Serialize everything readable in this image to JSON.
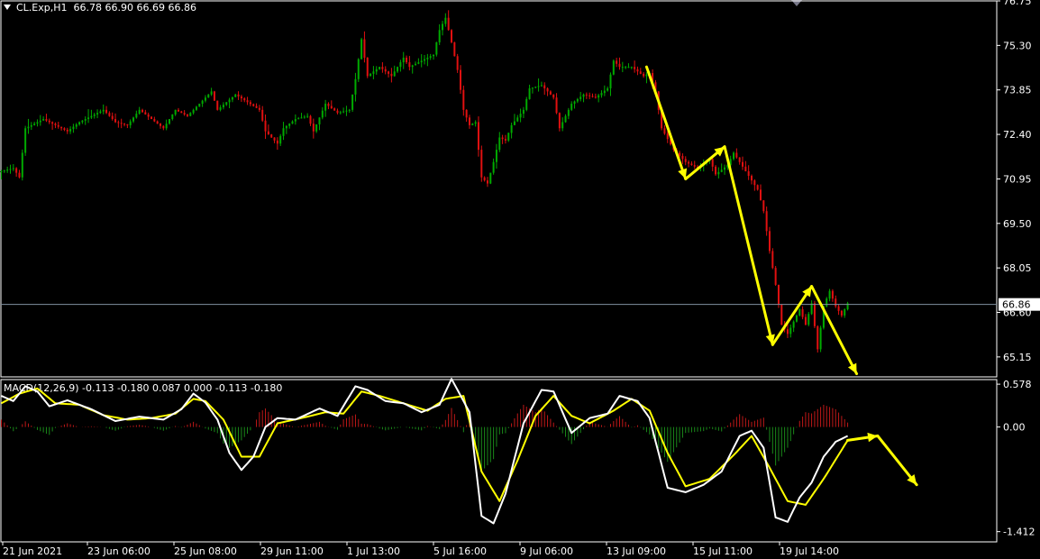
{
  "header": {
    "symbol_line": "CL.Exp,H1  66.78 66.90 66.69 66.86",
    "macd_line": "MACD(12,26,9) -0.113 -0.180 0.087 0.000 -0.113 -0.180"
  },
  "colors": {
    "background": "#000000",
    "frame": "#ffffff",
    "bull_candle": "#00aa00",
    "bear_candle": "#e01010",
    "macd_line": "#ffffff",
    "signal_line": "#ffff00",
    "hist_positive": "#c01818",
    "hist_negative": "#1a8a1a",
    "arrow": "#ffff00",
    "price_line": "#8090a0"
  },
  "icons": {
    "menu": "triangle-down-icon",
    "scroll": "triangle-down-icon"
  },
  "chart_data": [
    {
      "type": "candlestick",
      "title": "CL.Exp,H1",
      "ylim": [
        64.5,
        76.75
      ],
      "y_ticks": [
        "76.75",
        "75.30",
        "73.85",
        "72.40",
        "70.95",
        "69.50",
        "68.05",
        "66.60",
        "65.15"
      ],
      "current_price": "66.86",
      "x_ticks": [
        "21 Jun 2021",
        "23 Jun 06:00",
        "25 Jun 08:00",
        "29 Jun 11:00",
        "1 Jul 13:00",
        "5 Jul 16:00",
        "9 Jul 06:00",
        "13 Jul 09:00",
        "15 Jul 11:00",
        "19 Jul 14:00"
      ],
      "close_path": [
        [
          0,
          71.2
        ],
        [
          4,
          71.3
        ],
        [
          6,
          71.0
        ],
        [
          8,
          72.6
        ],
        [
          14,
          72.9
        ],
        [
          18,
          72.7
        ],
        [
          22,
          72.5
        ],
        [
          26,
          72.8
        ],
        [
          30,
          73.0
        ],
        [
          34,
          73.2
        ],
        [
          38,
          72.8
        ],
        [
          42,
          72.7
        ],
        [
          46,
          73.2
        ],
        [
          50,
          72.9
        ],
        [
          54,
          72.6
        ],
        [
          58,
          73.2
        ],
        [
          62,
          73.0
        ],
        [
          66,
          73.4
        ],
        [
          70,
          73.8
        ],
        [
          72,
          73.2
        ],
        [
          78,
          73.7
        ],
        [
          86,
          73.2
        ],
        [
          88,
          72.5
        ],
        [
          92,
          72.1
        ],
        [
          94,
          72.6
        ],
        [
          98,
          72.9
        ],
        [
          102,
          73.0
        ],
        [
          104,
          72.5
        ],
        [
          108,
          73.4
        ],
        [
          112,
          73.1
        ],
        [
          116,
          73.2
        ],
        [
          118,
          74.2
        ],
        [
          120,
          75.5
        ],
        [
          122,
          74.3
        ],
        [
          126,
          74.6
        ],
        [
          130,
          74.3
        ],
        [
          134,
          74.9
        ],
        [
          136,
          74.6
        ],
        [
          140,
          74.8
        ],
        [
          144,
          75.0
        ],
        [
          146,
          75.8
        ],
        [
          148,
          76.2
        ],
        [
          150,
          75.4
        ],
        [
          152,
          74.5
        ],
        [
          154,
          73.2
        ],
        [
          156,
          72.7
        ],
        [
          158,
          72.8
        ],
        [
          160,
          71.0
        ],
        [
          162,
          70.8
        ],
        [
          164,
          71.5
        ],
        [
          166,
          72.3
        ],
        [
          168,
          72.2
        ],
        [
          170,
          72.7
        ],
        [
          174,
          73.2
        ],
        [
          176,
          73.9
        ],
        [
          180,
          74.0
        ],
        [
          184,
          73.6
        ],
        [
          186,
          72.6
        ],
        [
          190,
          73.4
        ],
        [
          194,
          73.7
        ],
        [
          198,
          73.6
        ],
        [
          202,
          73.9
        ],
        [
          204,
          74.8
        ],
        [
          206,
          74.6
        ],
        [
          210,
          74.6
        ],
        [
          214,
          74.3
        ],
        [
          216,
          74.4
        ],
        [
          218,
          73.8
        ],
        [
          220,
          72.6
        ],
        [
          224,
          71.9
        ],
        [
          228,
          71.5
        ],
        [
          232,
          71.3
        ],
        [
          236,
          71.6
        ],
        [
          238,
          71.1
        ],
        [
          242,
          71.4
        ],
        [
          244,
          71.8
        ],
        [
          248,
          71.2
        ],
        [
          250,
          70.9
        ],
        [
          252,
          70.6
        ],
        [
          254,
          69.9
        ],
        [
          256,
          68.6
        ],
        [
          258,
          67.5
        ],
        [
          260,
          66.2
        ],
        [
          262,
          65.9
        ],
        [
          264,
          66.3
        ],
        [
          266,
          66.7
        ],
        [
          268,
          66.2
        ],
        [
          270,
          66.9
        ],
        [
          272,
          65.4
        ],
        [
          274,
          66.8
        ],
        [
          276,
          67.3
        ],
        [
          278,
          66.8
        ],
        [
          280,
          66.5
        ],
        [
          282,
          66.9
        ]
      ],
      "candle_count": 283
    },
    {
      "type": "macd",
      "name": "MACD(12,26,9)",
      "params": [
        12,
        26,
        9
      ],
      "values_shown": [
        "-0.113",
        "-0.180",
        "0.087",
        "0.000",
        "-0.113",
        "-0.180"
      ],
      "ylim": [
        -1.55,
        0.64
      ],
      "y_ticks": [
        "0.578",
        "0.00",
        "-1.412"
      ],
      "macd_path": [
        [
          0,
          0.42
        ],
        [
          4,
          0.35
        ],
        [
          8,
          0.55
        ],
        [
          12,
          0.48
        ],
        [
          16,
          0.28
        ],
        [
          22,
          0.36
        ],
        [
          30,
          0.24
        ],
        [
          38,
          0.08
        ],
        [
          46,
          0.14
        ],
        [
          54,
          0.1
        ],
        [
          60,
          0.24
        ],
        [
          64,
          0.45
        ],
        [
          68,
          0.33
        ],
        [
          72,
          0.1
        ],
        [
          76,
          -0.35
        ],
        [
          80,
          -0.58
        ],
        [
          84,
          -0.4
        ],
        [
          88,
          0.0
        ],
        [
          92,
          0.12
        ],
        [
          98,
          0.1
        ],
        [
          106,
          0.25
        ],
        [
          112,
          0.15
        ],
        [
          118,
          0.55
        ],
        [
          122,
          0.5
        ],
        [
          128,
          0.35
        ],
        [
          134,
          0.32
        ],
        [
          140,
          0.2
        ],
        [
          146,
          0.3
        ],
        [
          150,
          0.65
        ],
        [
          156,
          0.2
        ],
        [
          160,
          -1.2
        ],
        [
          164,
          -1.3
        ],
        [
          168,
          -0.9
        ],
        [
          174,
          0.05
        ],
        [
          180,
          0.5
        ],
        [
          184,
          0.48
        ],
        [
          190,
          -0.08
        ],
        [
          196,
          0.12
        ],
        [
          202,
          0.18
        ],
        [
          206,
          0.42
        ],
        [
          212,
          0.35
        ],
        [
          216,
          0.12
        ],
        [
          222,
          -0.82
        ],
        [
          228,
          -0.88
        ],
        [
          234,
          -0.78
        ],
        [
          240,
          -0.6
        ],
        [
          246,
          -0.12
        ],
        [
          250,
          -0.05
        ],
        [
          254,
          -0.28
        ],
        [
          258,
          -1.22
        ],
        [
          262,
          -1.28
        ],
        [
          266,
          -0.95
        ],
        [
          270,
          -0.75
        ],
        [
          274,
          -0.4
        ],
        [
          278,
          -0.2
        ],
        [
          282,
          -0.12
        ]
      ],
      "signal_path": [
        [
          0,
          0.32
        ],
        [
          6,
          0.45
        ],
        [
          12,
          0.52
        ],
        [
          18,
          0.32
        ],
        [
          26,
          0.3
        ],
        [
          34,
          0.16
        ],
        [
          42,
          0.1
        ],
        [
          50,
          0.12
        ],
        [
          58,
          0.18
        ],
        [
          64,
          0.38
        ],
        [
          68,
          0.35
        ],
        [
          74,
          0.1
        ],
        [
          80,
          -0.4
        ],
        [
          86,
          -0.4
        ],
        [
          92,
          0.05
        ],
        [
          100,
          0.12
        ],
        [
          108,
          0.2
        ],
        [
          114,
          0.18
        ],
        [
          120,
          0.48
        ],
        [
          126,
          0.42
        ],
        [
          134,
          0.32
        ],
        [
          142,
          0.22
        ],
        [
          148,
          0.38
        ],
        [
          154,
          0.42
        ],
        [
          160,
          -0.6
        ],
        [
          166,
          -1.0
        ],
        [
          172,
          -0.45
        ],
        [
          178,
          0.15
        ],
        [
          184,
          0.42
        ],
        [
          190,
          0.15
        ],
        [
          196,
          0.05
        ],
        [
          204,
          0.22
        ],
        [
          210,
          0.38
        ],
        [
          216,
          0.22
        ],
        [
          222,
          -0.35
        ],
        [
          228,
          -0.8
        ],
        [
          236,
          -0.7
        ],
        [
          244,
          -0.38
        ],
        [
          250,
          -0.12
        ],
        [
          256,
          -0.55
        ],
        [
          262,
          -1.0
        ],
        [
          268,
          -1.05
        ],
        [
          274,
          -0.7
        ],
        [
          282,
          -0.18
        ]
      ]
    }
  ],
  "annotations": {
    "price_arrows": [
      [
        [
          215,
          74.6
        ],
        [
          228,
          70.95
        ]
      ],
      [
        [
          228,
          70.95
        ],
        [
          241,
          72.0
        ]
      ],
      [
        [
          241,
          72.0
        ],
        [
          257,
          65.55
        ]
      ],
      [
        [
          257,
          65.55
        ],
        [
          270,
          67.45
        ]
      ],
      [
        [
          270,
          67.45
        ],
        [
          285,
          64.6
        ]
      ]
    ],
    "macd_arrows": [
      [
        [
          282,
          -0.18
        ],
        [
          292,
          -0.12
        ]
      ],
      [
        [
          292,
          -0.12
        ],
        [
          305,
          -0.78
        ]
      ]
    ]
  }
}
